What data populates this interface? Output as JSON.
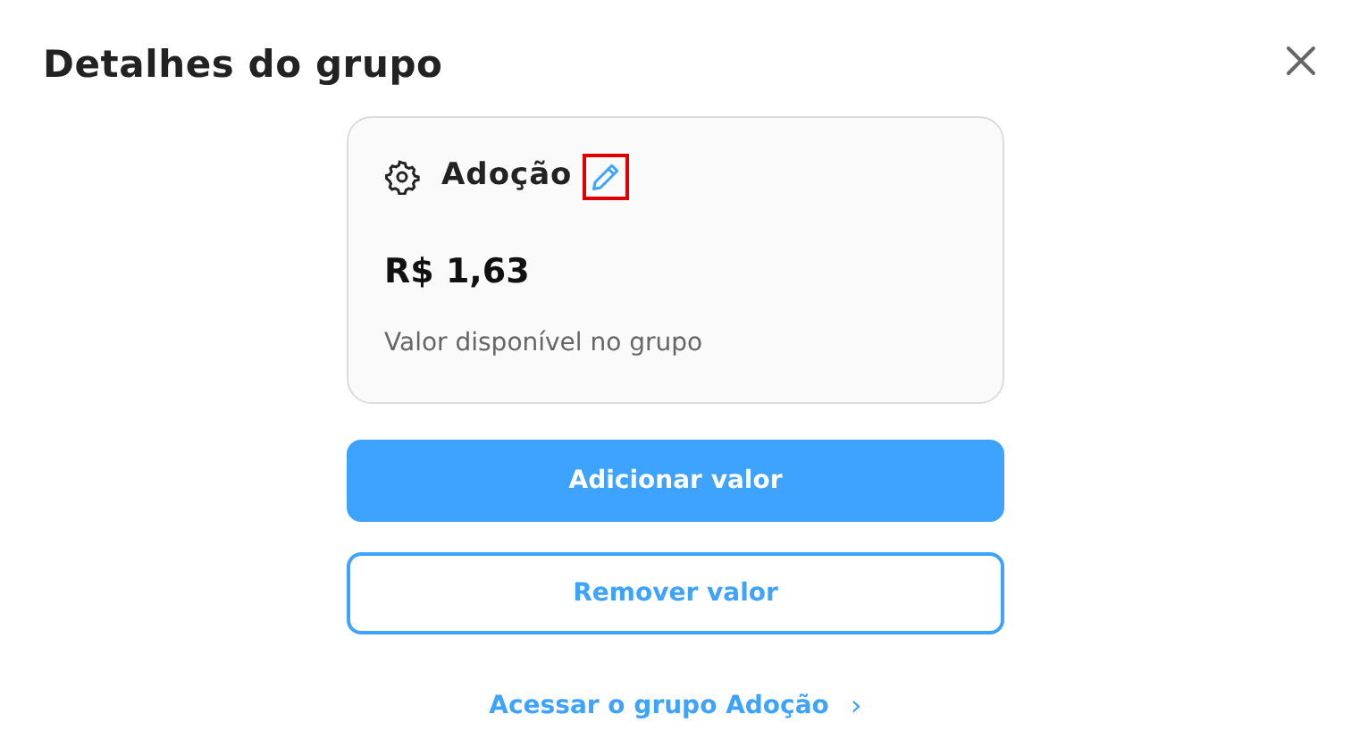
{
  "dialog": {
    "title": "Detalhes do grupo"
  },
  "group_card": {
    "name": "Adoção",
    "edit_highlighted": true,
    "amount": "R$ 1,63",
    "caption": "Valor disponível no grupo"
  },
  "buttons": [
    {
      "label": "Adicionar valor",
      "kind": "primary"
    },
    {
      "label": "Remover valor",
      "kind": "outline"
    }
  ],
  "link": {
    "label": "Acessar o grupo Adoção",
    "chevron": "›"
  }
}
